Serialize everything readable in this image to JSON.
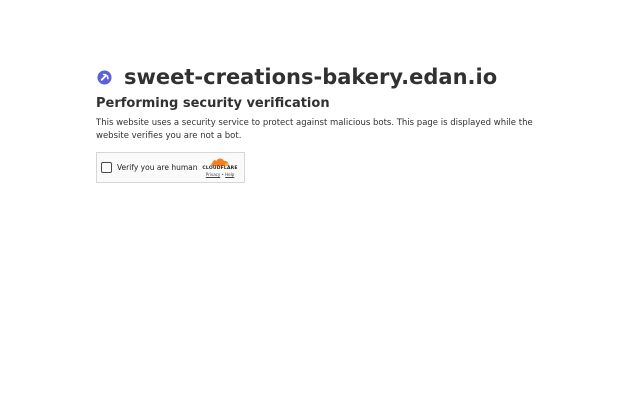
{
  "site": {
    "domain": "sweet-creations-bakery.edan.io",
    "icon": "site-favicon-icon",
    "accent_color": "#5b61d6"
  },
  "main": {
    "heading": "Performing security verification",
    "description": "This website uses a security service to protect against malicious bots. This page is displayed while the website verifies you are not a bot."
  },
  "widget": {
    "checkbox_label": "Verify you are human",
    "brand": "CLOUDFLARE",
    "brand_color": "#f38020",
    "privacy_link": "Privacy",
    "separator": "•",
    "help_link": "Help"
  }
}
